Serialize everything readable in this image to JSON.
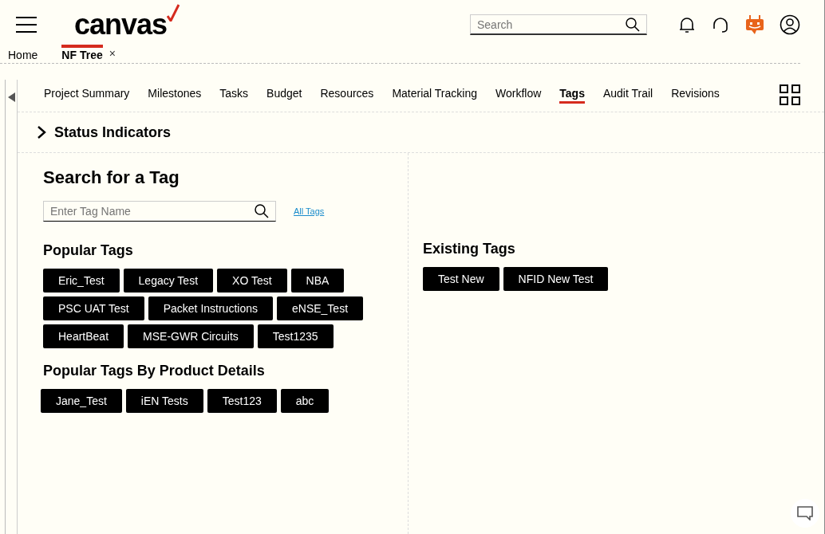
{
  "header": {
    "logo": "canvas",
    "search": {
      "placeholder": "Search"
    }
  },
  "open_tabs": [
    {
      "label": "Home",
      "selected": false
    },
    {
      "label": "NF Tree",
      "selected": true,
      "close": "×"
    }
  ],
  "nav_tabs": [
    {
      "label": "Project Summary",
      "selected": false
    },
    {
      "label": "Milestones",
      "selected": false
    },
    {
      "label": "Tasks",
      "selected": false
    },
    {
      "label": "Budget",
      "selected": false
    },
    {
      "label": "Resources",
      "selected": false
    },
    {
      "label": "Material Tracking",
      "selected": false
    },
    {
      "label": "Workflow",
      "selected": false
    },
    {
      "label": "Tags",
      "selected": true
    },
    {
      "label": "Audit Trail",
      "selected": false
    },
    {
      "label": "Revisions",
      "selected": false
    }
  ],
  "status_section": {
    "title": "Status Indicators",
    "expanded": false
  },
  "search_panel": {
    "title": "Search for a Tag",
    "field": {
      "placeholder": "Enter Tag Name"
    },
    "link": "All Tags"
  },
  "popular_tags": {
    "title": "Popular Tags",
    "tags": [
      "Eric_Test",
      "Legacy Test",
      "XO Test",
      "NBA",
      "PSC UAT Test",
      "Packet Instructions",
      "eNSE_Test",
      "HeartBeat",
      "MSE-GWR Circuits",
      "Test1235"
    ]
  },
  "product_tags": {
    "title": "Popular Tags By Product Details",
    "tags": [
      "Jane_Test",
      "iEN Tests",
      "Test123",
      "abc"
    ]
  },
  "existing_tags": {
    "title": "Existing Tags",
    "tags": [
      "Test New",
      "NFID New Test"
    ]
  }
}
